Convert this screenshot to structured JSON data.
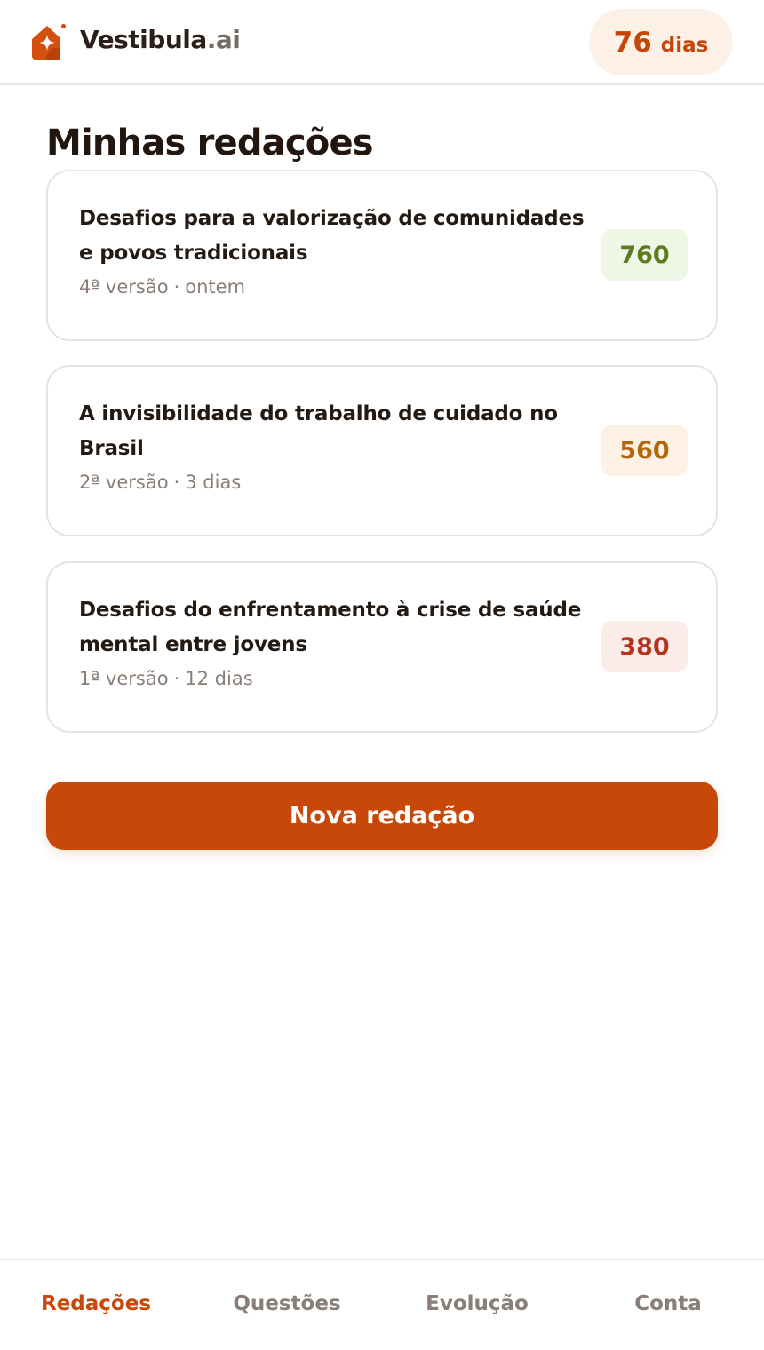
{
  "header": {
    "brand_name": "Vestibula",
    "brand_suffix": ".ai",
    "days_value": "76",
    "days_label": "dias"
  },
  "page_title": "Minhas redações",
  "essays": [
    {
      "title": "Desafios para a valorização de comunidades e povos tradicionais",
      "version": "4ª versão",
      "separator": "·",
      "date": "ontem",
      "score": "760",
      "score_color": "#5e7a1e",
      "score_bg": "#eef6e6"
    },
    {
      "title": "A invisibilidade do trabalho de cuidado no Brasil",
      "version": "2ª versão",
      "separator": "·",
      "date": "3 dias",
      "score": "560",
      "score_color": "#b3660c",
      "score_bg": "#fdf1e4"
    },
    {
      "title": "Desafios do enfrentamento à crise de saúde mental entre jovens",
      "version": "1ª versão",
      "separator": "·",
      "date": "12 dias",
      "score": "380",
      "score_color": "#b3331c",
      "score_bg": "#fbece9"
    }
  ],
  "new_button_label": "Nova redação",
  "nav": {
    "items": [
      {
        "label": "Redações",
        "active": true
      },
      {
        "label": "Questões",
        "active": false
      },
      {
        "label": "Evolução",
        "active": false
      },
      {
        "label": "Conta",
        "active": false
      }
    ]
  },
  "colors": {
    "accent": "#c74809",
    "text": "#241a14",
    "muted": "#8a7f78"
  }
}
